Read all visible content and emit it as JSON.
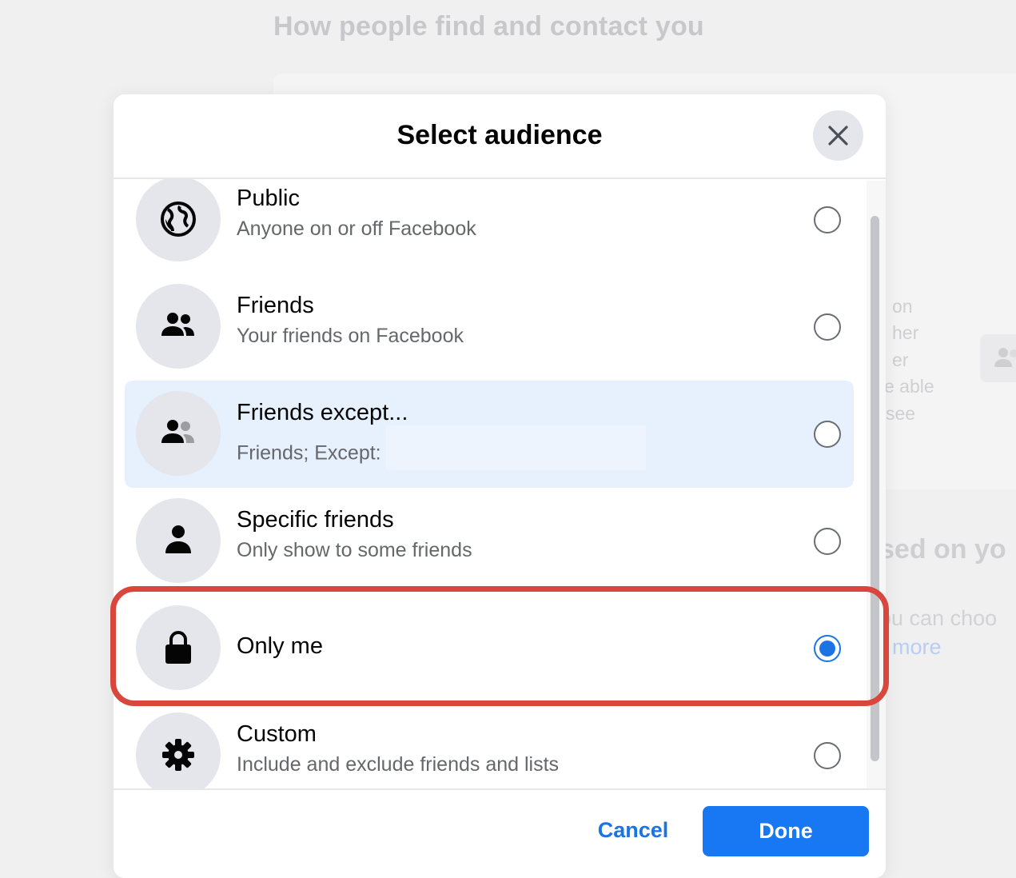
{
  "background": {
    "page_title": "How people find and contact you",
    "side_text_lines": [
      "on",
      "her",
      "er",
      "e able",
      "see"
    ],
    "section_heading": "sed on yo",
    "section_sub": "ou can choo",
    "section_link": "more"
  },
  "dialog": {
    "title": "Select audience",
    "close_icon": "close-icon",
    "options": [
      {
        "label": "Public",
        "description": "Anyone on or off Facebook",
        "icon": "globe-icon",
        "selected": false
      },
      {
        "label": "Friends",
        "description": "Your friends on Facebook",
        "icon": "friends-icon",
        "selected": false
      },
      {
        "label": "Friends except...",
        "description": "Friends; Except:",
        "icon": "friends-except-icon",
        "selected": false
      },
      {
        "label": "Specific friends",
        "description": "Only show to some friends",
        "icon": "person-icon",
        "selected": false
      },
      {
        "label": "Only me",
        "description": "",
        "icon": "lock-icon",
        "selected": true
      },
      {
        "label": "Custom",
        "description": "Include and exclude friends and lists",
        "icon": "gear-icon",
        "selected": false
      }
    ],
    "cancel_label": "Cancel",
    "done_label": "Done"
  },
  "colors": {
    "accent": "#1877f2",
    "link": "#1b74e4",
    "highlight_row": "#e7f0fd",
    "annotation": "#d9463c"
  }
}
